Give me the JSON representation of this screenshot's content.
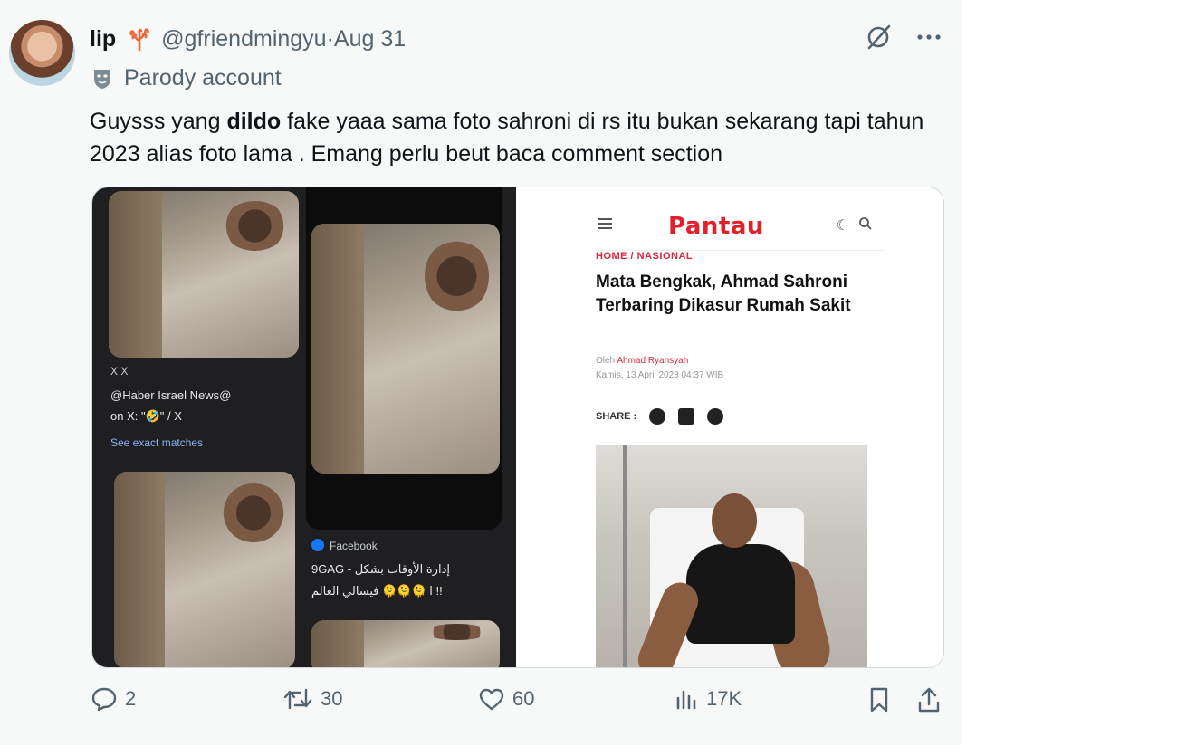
{
  "tweet": {
    "display_name": "lip",
    "handle": "@gfriendmingyu",
    "separator": " · ",
    "date": "Aug 31",
    "label": "Parody account",
    "text_pre": "Guysss yang ",
    "text_bold": "dildo",
    "text_post": " fake yaaa sama foto sahroni di rs itu bukan sekarang tapi tahun 2023 alias foto lama . Emang perlu beut baca comment section"
  },
  "media": {
    "left": {
      "label_x": "X  X",
      "label_line1": "@Haber Israel News@",
      "label_line2": "on X: \"🤣\" / X",
      "see_exact": "See exact matches",
      "facebook_label": "Facebook",
      "fb_line1": "9GAG - إدارة الأوقات بشكل",
      "fb_line2": "ا 🫠🫠🫠 فيسالي العالم !!"
    },
    "right": {
      "logo": "Pantau",
      "breadcrumb": "HOME / NASIONAL",
      "title": "Mata Bengkak, Ahmad Sahroni Terbaring Dikasur Rumah Sakit",
      "byline_prefix": "Oleh ",
      "author": "Ahmad Ryansyah",
      "dateline": "Kamis, 13 April 2023 04:37 WIB",
      "share_label": "SHARE :"
    }
  },
  "actions": {
    "replies": "2",
    "reposts": "30",
    "likes": "60",
    "views": "17K"
  },
  "colors": {
    "background": "#f7f8f8",
    "secondary_text": "#536471",
    "brand_red": "#e0202a"
  }
}
